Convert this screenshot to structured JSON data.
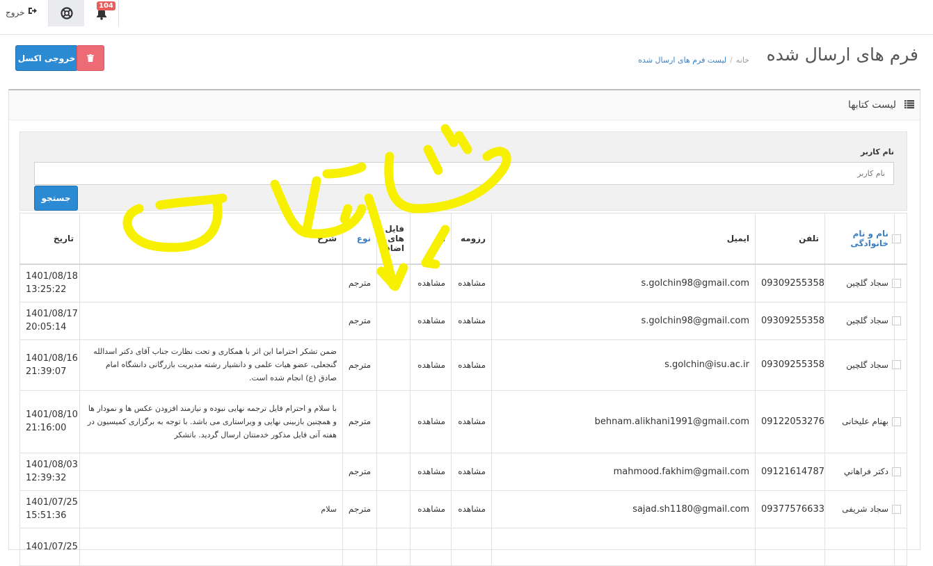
{
  "topbar": {
    "logout_label": "خروج",
    "notification_count": "104"
  },
  "header": {
    "title": "فرم های ارسال شده",
    "breadcrumb": {
      "home": "خانه",
      "separator": "/",
      "current": "لیست فرم های ارسال شده"
    },
    "excel_button": "خروجی اکسل"
  },
  "portlet": {
    "title": "لیست کتابها"
  },
  "search": {
    "label": "نام کاربر",
    "placeholder": "نام کاربر",
    "button": "جستجو"
  },
  "table": {
    "columns": {
      "name": "نام و نام خانوادگی",
      "phone": "تلفن",
      "email": "ایمیل",
      "resume": "رزومه",
      "work": "اثر",
      "files": "فایل های اضافه",
      "type": "نوع",
      "desc": "شرح",
      "date": "تاریخ"
    },
    "rows": [
      {
        "name": "سجاد گلچین",
        "phone": "09309255358",
        "email": "s.golchin98@gmail.com",
        "resume": "مشاهده",
        "work": "مشاهده",
        "files": "",
        "type": "مترجم",
        "desc": "",
        "date1": "1401/08/18",
        "date2": "13:25:22"
      },
      {
        "name": "سجاد گلچین",
        "phone": "09309255358",
        "email": "s.golchin98@gmail.com",
        "resume": "مشاهده",
        "work": "مشاهده",
        "files": "",
        "type": "مترجم",
        "desc": "",
        "date1": "1401/08/17",
        "date2": "20:05:14"
      },
      {
        "name": "سجاد گلچین",
        "phone": "09309255358",
        "email": "s.golchin@isu.ac.ir",
        "resume": "مشاهده",
        "work": "مشاهده",
        "files": "",
        "type": "مترجم",
        "desc": "ضمن تشکر احتراما این اثر با همکاری و تحت نظارت جناب آقای دکتر اسدالله گنجعلی، عضو هیات علمی و دانشیار رشته مدیریت بازرگانی دانشگاه امام صادق (ع) انجام شده است.",
        "date1": "1401/08/16",
        "date2": "21:39:07"
      },
      {
        "name": "بهنام علیخانی",
        "phone": "09122053276",
        "email": "behnam.alikhani1991@gmail.com",
        "resume": "مشاهده",
        "work": "مشاهده",
        "files": "",
        "type": "مترجم",
        "desc": "با سلام و احترام فایل ترجمه نهایی نبوده و نیازمند افزودن عکس ها و نمودار ها و همچنین بازبینی نهایی و ویراستاری می باشد. با توجه به برگزاری کمیسیون در هفته آتی فایل مذکور خدمتتان ارسال گردید. باتشکر",
        "date1": "1401/08/10",
        "date2": "21:16:00"
      },
      {
        "name": "دکتر فراهاني",
        "phone": "09121614787",
        "email": "mahmood.fakhim@gmail.com",
        "resume": "مشاهده",
        "work": "مشاهده",
        "files": "",
        "type": "مترجم",
        "desc": "",
        "date1": "1401/08/03",
        "date2": "12:39:32"
      },
      {
        "name": "سجاد شریفی",
        "phone": "09377576633",
        "email": "sajad.sh1180@gmail.com",
        "resume": "مشاهده",
        "work": "مشاهده",
        "files": "",
        "type": "مترجم",
        "desc": "سلام",
        "date1": "1401/07/25",
        "date2": "15:51:36"
      },
      {
        "name": "",
        "phone": "",
        "email": "",
        "resume": "",
        "work": "",
        "files": "",
        "type": "",
        "desc": "",
        "date1": "1401/07/25",
        "date2": ""
      }
    ]
  },
  "colors": {
    "primary": "#2c8ad3",
    "danger": "#ed6b75",
    "link": "#3b7fc4",
    "badge": "#e95c5c",
    "annotation": "#f7f000"
  },
  "icons": {
    "logout": "logout-icon",
    "help": "lifebuoy-icon",
    "notifications": "bell-icon",
    "delete": "trash-icon",
    "list": "list-icon"
  }
}
